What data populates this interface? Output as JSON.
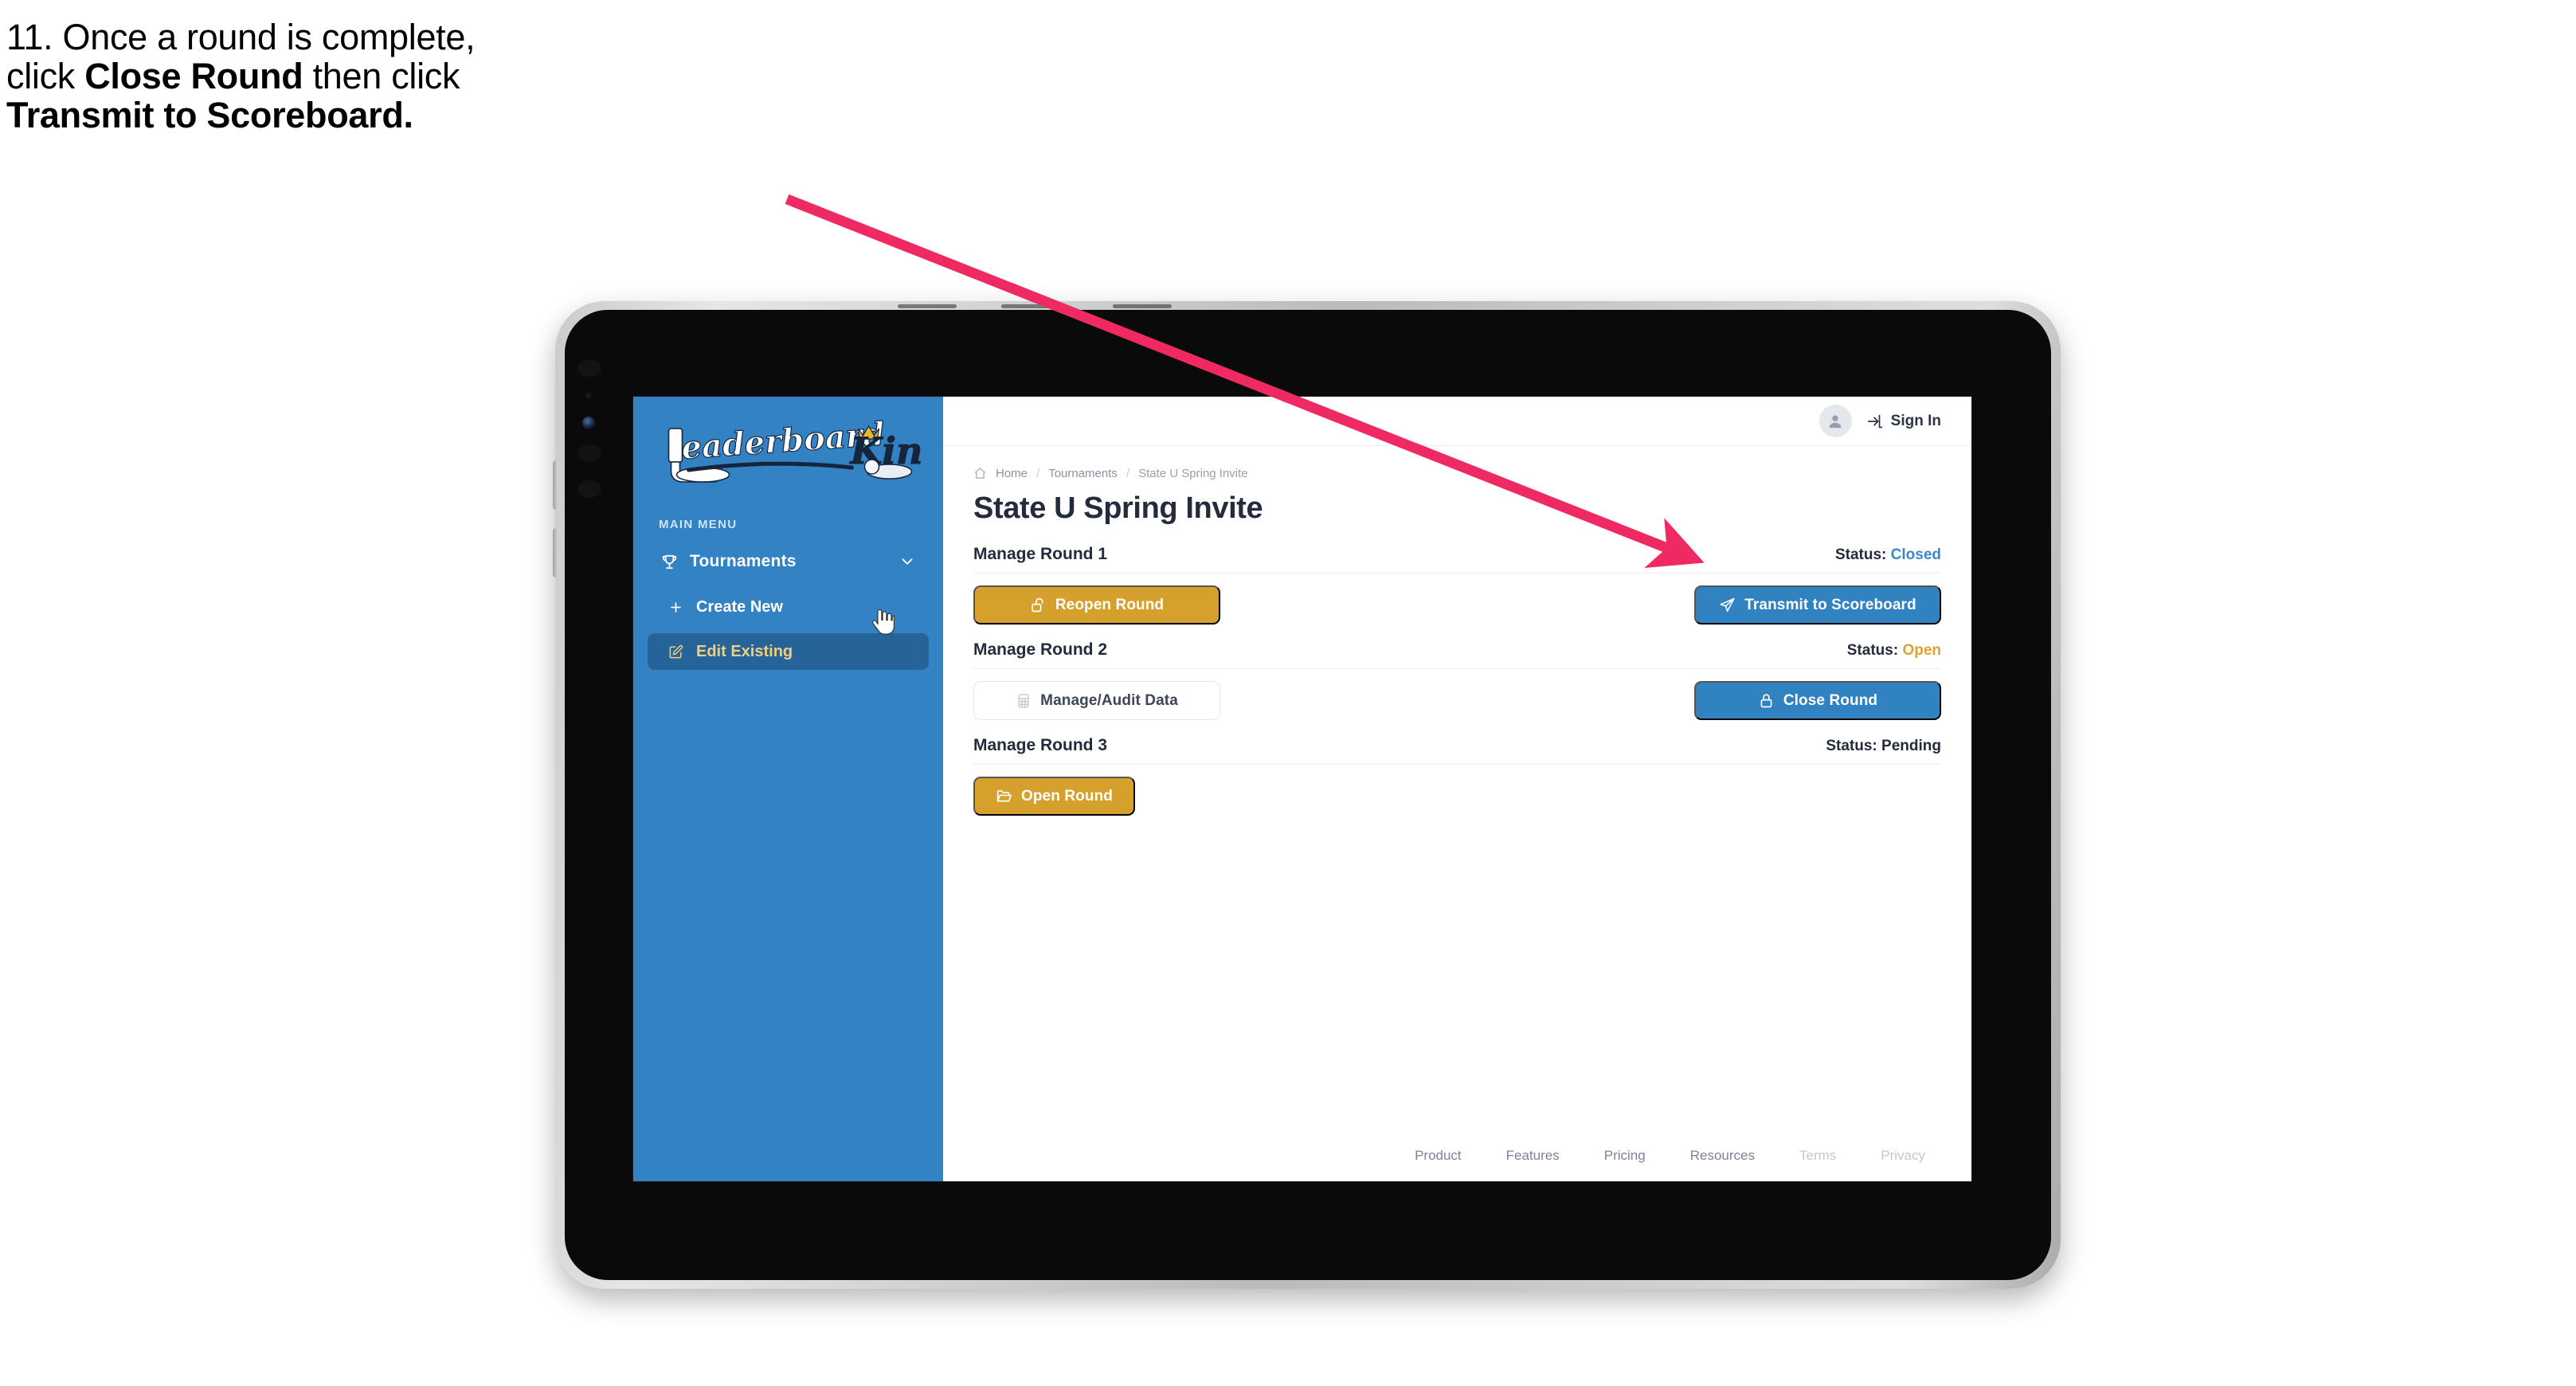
{
  "caption": {
    "line1": "11. Once a round is complete,",
    "line2_pre": "click ",
    "line2_bold": "Close Round",
    "line2_post": " then click",
    "line3_bold": "Transmit to Scoreboard."
  },
  "annotation": {
    "arrow_color": "#ef2a63"
  },
  "sidebar": {
    "logo_word_1": "Leaderboard",
    "logo_word_2": "King",
    "main_menu_label": "MAIN MENU",
    "items": [
      {
        "label": "Tournaments",
        "icon": "trophy-icon",
        "chevron": "chevron-down-icon"
      },
      {
        "label": "Create New",
        "icon": "plus-icon"
      },
      {
        "label": "Edit Existing",
        "icon": "edit-pencil-icon"
      }
    ]
  },
  "topbar": {
    "avatar_icon": "user-avatar-icon",
    "signin_icon": "sign-in-arrow-icon",
    "signin_label": "Sign In"
  },
  "breadcrumb": {
    "home_icon": "home-icon",
    "items": [
      "Home",
      "Tournaments",
      "State U Spring Invite"
    ],
    "separator": "/"
  },
  "page_title": "State U Spring Invite",
  "rounds": [
    {
      "title": "Manage Round 1",
      "status_label": "Status:",
      "status_value": "Closed",
      "status_kind": "closed",
      "left_button": {
        "label": "Reopen Round",
        "icon": "unlock-icon",
        "style": "gold"
      },
      "right_button": {
        "label": "Transmit to Scoreboard",
        "icon": "send-plane-icon",
        "style": "blue"
      }
    },
    {
      "title": "Manage Round 2",
      "status_label": "Status:",
      "status_value": "Open",
      "status_kind": "open",
      "left_button": {
        "label": "Manage/Audit Data",
        "icon": "table-grid-icon",
        "style": "ghost"
      },
      "right_button": {
        "label": "Close Round",
        "icon": "lock-icon",
        "style": "blue"
      }
    },
    {
      "title": "Manage Round 3",
      "status_label": "Status:",
      "status_value": "Pending",
      "status_kind": "pending",
      "left_button": {
        "label": "Open Round",
        "icon": "folder-open-icon",
        "style": "gold"
      },
      "right_button": null
    }
  ],
  "footer": {
    "links": [
      "Product",
      "Features",
      "Pricing",
      "Resources",
      "Terms",
      "Privacy"
    ]
  },
  "colors": {
    "sidebar_blue": "#3282c4",
    "sidebar_active": "#256398",
    "active_text_gold": "#f2cf7d",
    "button_gold": "#d6a02c",
    "button_blue": "#3182c0",
    "status_closed": "#3b86cc",
    "status_open": "#e0a133",
    "title_navy": "#232b3c"
  }
}
